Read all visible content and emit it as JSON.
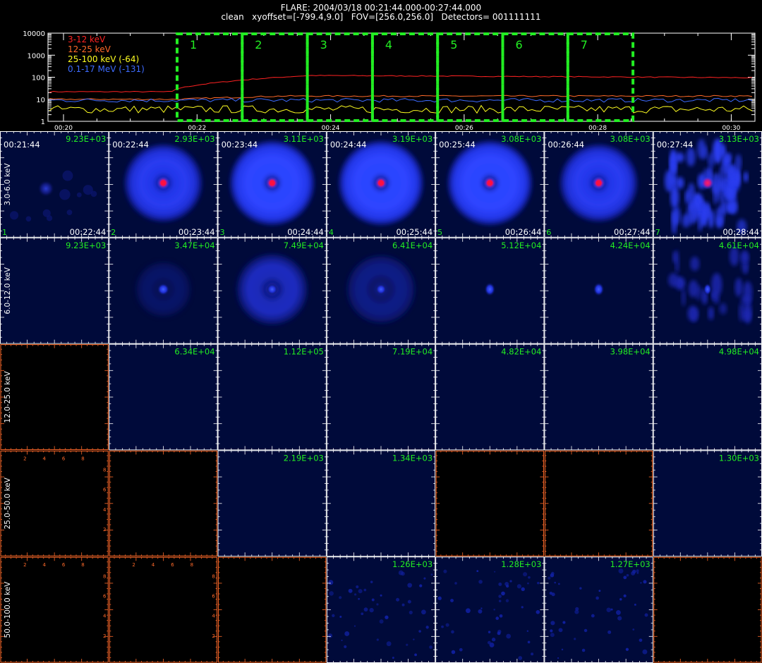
{
  "header": {
    "title_line1": "FLARE: 2004/03/18 00:21:44.000-00:27:44.000",
    "title_line2": "clean   xyoffset=[-799.4,9.0]   FOV=[256.0,256.0]   Detectors= 001111111"
  },
  "colors": {
    "green": "#22ee22",
    "red": "#ff2222",
    "orange": "#ff6a2a",
    "yellow": "#ffff22",
    "blue": "#3d6bff",
    "white": "#ffffff",
    "image_bg": "#000a3a"
  },
  "lightcurve": {
    "y_ticks": [
      "10000",
      "1000",
      "100",
      "10",
      "1"
    ],
    "x_ticks": [
      "00:20",
      "00:22",
      "00:24",
      "00:26",
      "00:28",
      "00:30"
    ],
    "legend": [
      {
        "label": "3-12 keV",
        "color": "#ff2222"
      },
      {
        "label": "12-25 keV",
        "color": "#ff6a2a"
      },
      {
        "label": "25-100 keV (-64)",
        "color": "#ffff22"
      },
      {
        "label": "0.1-17 MeV (-131)",
        "color": "#3d6bff"
      }
    ],
    "intervals": [
      "1",
      "2",
      "3",
      "4",
      "5",
      "6",
      "7"
    ]
  },
  "grid": {
    "energy_bands": [
      "3.0-6.0 keV",
      "6.0-12.0 keV",
      "12.0-25.0 keV",
      "25.0-50.0 keV",
      "50.0-100.0 keV"
    ],
    "start_times": [
      "00:21:44",
      "00:22:44",
      "00:23:44",
      "00:24:44",
      "00:25:44",
      "00:26:44",
      "00:27:44"
    ],
    "end_times": [
      "00:22:44",
      "00:23:44",
      "00:24:44",
      "00:25:44",
      "00:26:44",
      "00:27:44",
      "00:28:44"
    ],
    "interval_numbers": [
      "1",
      "2",
      "3",
      "4",
      "5",
      "6",
      "7"
    ],
    "axis_tick_labels": [
      "2",
      "4",
      "6",
      "8"
    ],
    "cells": [
      [
        {
          "max": "9.23E+03",
          "image": "faint"
        },
        {
          "max": "2.93E+03",
          "image": "ring"
        },
        {
          "max": "3.11E+03",
          "image": "ring-bright"
        },
        {
          "max": "3.19E+03",
          "image": "ring-bright"
        },
        {
          "max": "3.08E+03",
          "image": "ring-bright"
        },
        {
          "max": "3.08E+03",
          "image": "ring"
        },
        {
          "max": "3.13E+03",
          "image": "noisy"
        }
      ],
      [
        {
          "max": "9.23E+03",
          "image": "blank"
        },
        {
          "max": "3.47E+04",
          "image": "spot-faint"
        },
        {
          "max": "7.49E+04",
          "image": "ring-mid"
        },
        {
          "max": "6.41E+04",
          "image": "ring-faint"
        },
        {
          "max": "5.12E+04",
          "image": "spot"
        },
        {
          "max": "4.24E+04",
          "image": "spot"
        },
        {
          "max": "4.61E+04",
          "image": "noisy-faint"
        }
      ],
      [
        {
          "max": "",
          "image": "empty"
        },
        {
          "max": "6.34E+04",
          "image": "blank"
        },
        {
          "max": "1.12E+05",
          "image": "blank"
        },
        {
          "max": "7.19E+04",
          "image": "blank"
        },
        {
          "max": "4.82E+04",
          "image": "blank"
        },
        {
          "max": "3.98E+04",
          "image": "blank"
        },
        {
          "max": "4.98E+04",
          "image": "blank"
        }
      ],
      [
        {
          "max": "",
          "image": "empty-axes"
        },
        {
          "max": "",
          "image": "empty"
        },
        {
          "max": "2.19E+03",
          "image": "blank"
        },
        {
          "max": "1.34E+03",
          "image": "blank"
        },
        {
          "max": "",
          "image": "empty"
        },
        {
          "max": "",
          "image": "empty"
        },
        {
          "max": "1.30E+03",
          "image": "blank"
        }
      ],
      [
        {
          "max": "",
          "image": "empty-axes"
        },
        {
          "max": "",
          "image": "empty-axes"
        },
        {
          "max": "",
          "image": "empty"
        },
        {
          "max": "1.26E+03",
          "image": "speckle"
        },
        {
          "max": "1.28E+03",
          "image": "speckle"
        },
        {
          "max": "1.27E+03",
          "image": "speckle"
        },
        {
          "max": "",
          "image": "empty"
        }
      ]
    ]
  }
}
